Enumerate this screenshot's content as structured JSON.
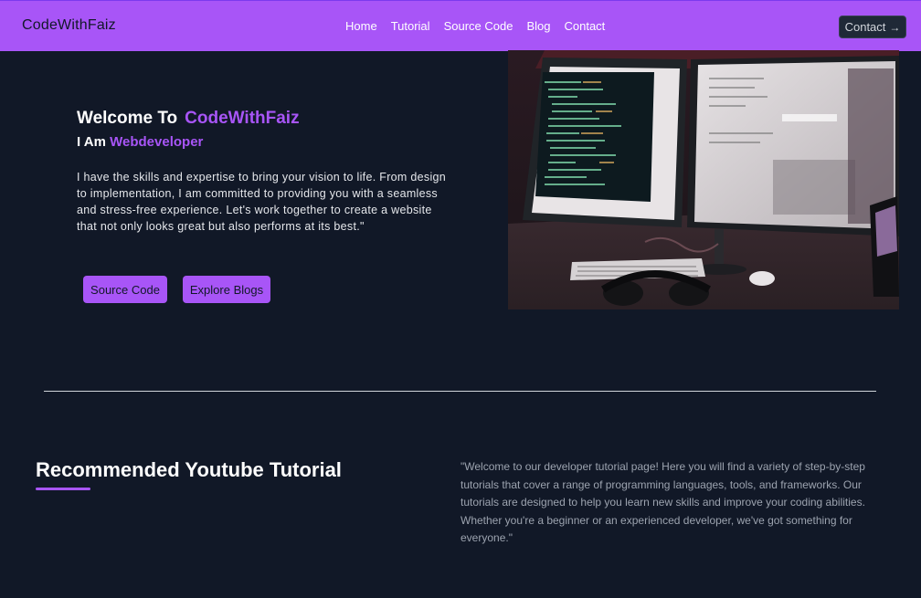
{
  "navbar": {
    "brand": "CodeWithFaiz",
    "links": [
      "Home",
      "Tutorial",
      "Source Code",
      "Blog",
      "Contact"
    ],
    "cta_label": "Contact",
    "cta_icon": "arrow-right-icon"
  },
  "hero": {
    "title_prefix": "Welcome To",
    "title_accent": "CodeWithFaiz",
    "sub_prefix": "I Am",
    "sub_accent": "Webdeveloper",
    "description": "I have the skills and expertise to bring your vision to life. From design to implementation, I am committed to providing you with a seamless and stress-free experience. Let's work together to create a website that not only looks great but also performs at its best.\"",
    "buttons": [
      "Source Code",
      "Explore Blogs"
    ]
  },
  "tutorial_section": {
    "title": "Recommended Youtube Tutorial",
    "description": "\"Welcome to our developer tutorial page! Here you will find a variety of step-by-step tutorials that cover a range of programming languages, tools, and frameworks. Our tutorials are designed to help you learn new skills and improve your coding abilities. Whether you're a beginner or an experienced developer, we've got something for everyone.\""
  },
  "colors": {
    "accent": "#a855f7",
    "background": "#111827",
    "nav_cta_bg": "#1f2937",
    "muted_text": "#9ca3af"
  }
}
